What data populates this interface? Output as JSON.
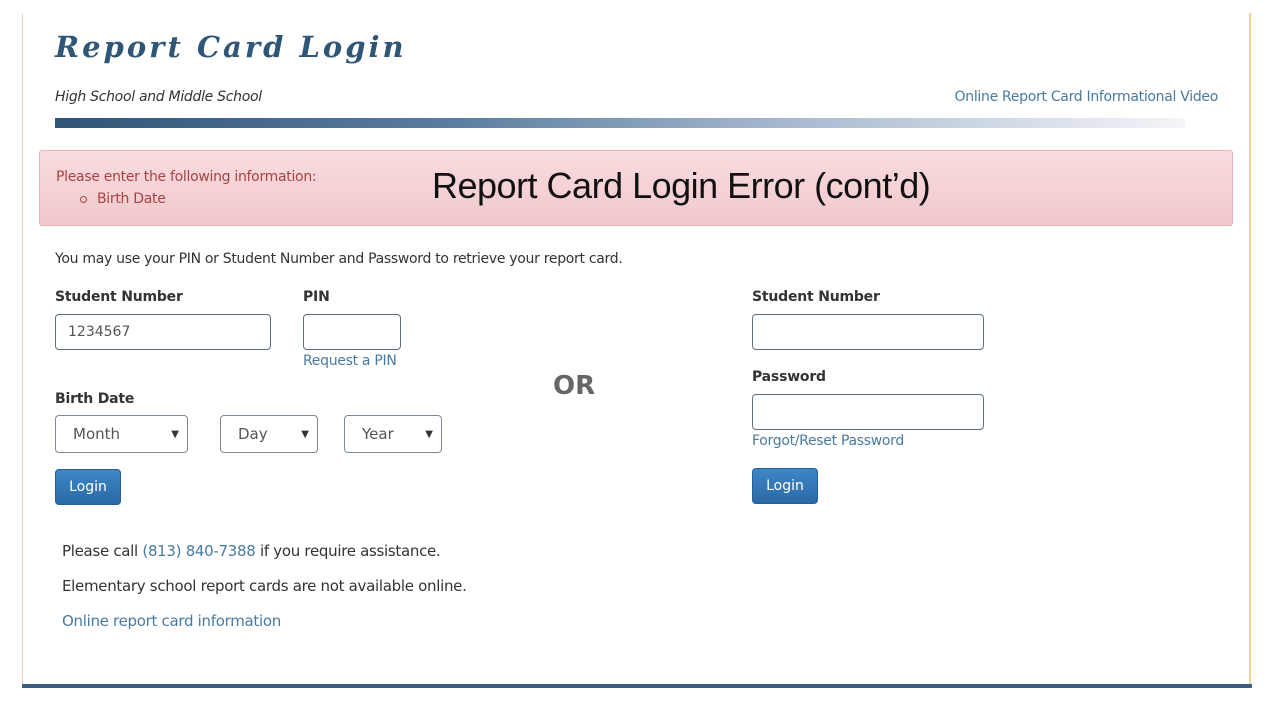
{
  "header": {
    "title": "Report Card Login",
    "subtitle": "High School and Middle School",
    "video_link": "Online Report Card Informational Video"
  },
  "alert": {
    "message": "Please enter the following information:",
    "missing_fields": [
      "Birth Date"
    ],
    "overlay_title": "Report Card Login Error (cont’d)"
  },
  "intro": "You may use your PIN or Student Number and Password to retrieve your report card.",
  "pin_form": {
    "student_number_label": "Student Number",
    "student_number_value": "1234567",
    "pin_label": "PIN",
    "pin_value": "",
    "request_pin_link": "Request a PIN",
    "birth_date_label": "Birth Date",
    "month": {
      "selected": "Month"
    },
    "day": {
      "selected": "Day"
    },
    "year": {
      "selected": "Year"
    },
    "login_button": "Login"
  },
  "separator": "OR",
  "password_form": {
    "student_number_label": "Student Number",
    "student_number_value": "",
    "password_label": "Password",
    "password_value": "",
    "forgot_link": "Forgot/Reset Password",
    "login_button": "Login"
  },
  "help": {
    "call_prefix": "Please call",
    "phone": "(813) 840-7388",
    "call_suffix": "if you require assistance.",
    "elementary_note": "Elementary school report cards are not available online.",
    "info_link": "Online report card information"
  },
  "icons": {
    "caret": "▼"
  },
  "colors": {
    "brand": "#2f5676",
    "link": "#4a7aa0",
    "button": "#2f72b0",
    "alert_bg": "#f5d3d6",
    "alert_text": "#a64444"
  }
}
